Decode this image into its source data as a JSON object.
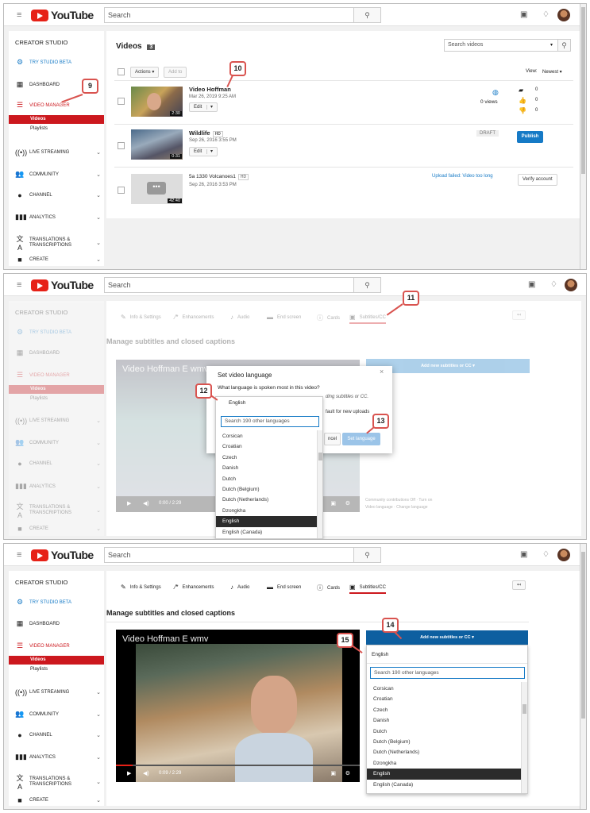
{
  "app": {
    "logo_text": "YouTube",
    "search_placeholder": "Search",
    "colors": {
      "brand_red": "#e62117",
      "accent_blue": "#167ac6",
      "sidebar_active": "#cc181e",
      "callout": "#d9534f"
    },
    "icons": {
      "menu": "hamburger-icon",
      "search": "search-icon",
      "upload": "video-camera-icon",
      "bell": "bell-icon"
    }
  },
  "sidebar": {
    "title": "CREATOR STUDIO",
    "items": [
      {
        "label": "TRY STUDIO BETA",
        "icon": "gear-icon"
      },
      {
        "label": "DASHBOARD",
        "icon": "dashboard-icon"
      },
      {
        "label": "VIDEO MANAGER",
        "icon": "video-manager-icon"
      },
      {
        "label": "LIVE STREAMING",
        "icon": "live-icon"
      },
      {
        "label": "COMMUNITY",
        "icon": "community-icon"
      },
      {
        "label": "CHANNEL",
        "icon": "channel-icon"
      },
      {
        "label": "ANALYTICS",
        "icon": "analytics-icon"
      },
      {
        "label": "TRANSLATIONS &",
        "label2": "TRANSCRIPTIONS",
        "icon": "translate-icon"
      },
      {
        "label": "CREATE",
        "icon": "create-icon"
      }
    ],
    "sub_items": [
      "Videos",
      "Playlists"
    ]
  },
  "video_manager": {
    "title": "Videos",
    "count": "3",
    "search_placeholder": "Search videos",
    "actions_label": "Actions ▾",
    "add_to_label": "Add to",
    "view_label": "View:",
    "view_value": "Newest ▾",
    "edit_label": "Edit",
    "videos": [
      {
        "title": "Video Hoffman",
        "date": "Mar 26, 2019 9:25 AM",
        "duration": "2:30",
        "views": "0 views",
        "likes": "0",
        "dislikes": "0",
        "comments": "0"
      },
      {
        "title": "Wildlife",
        "badge": "HD",
        "date": "Sep 26, 2016 3:55 PM",
        "duration": "0:31",
        "status": "DRAFT",
        "action": "Publish"
      },
      {
        "title": "5a 1330 Volcanoes1",
        "badge": "HD",
        "date": "Sep 26, 2016 3:53 PM",
        "duration": "42:40",
        "status": "Upload failed: Video too long",
        "action": "Verify account"
      }
    ]
  },
  "editor": {
    "tabs": [
      "Info & Settings",
      "Enhancements",
      "Audio",
      "End screen",
      "Cards",
      "Subtitles/CC"
    ],
    "heading": "Manage subtitles and closed captions",
    "video_title": "Video Hoffman E wmv",
    "time_panel2": "0:00 / 2:29",
    "time_panel3": "0:09 / 2:29",
    "add_subtitles_label": "Add new subtitles or CC ▾",
    "community_contrib": "Community contributions  Off · Turn on",
    "video_language": "Video language · Change language"
  },
  "dialog": {
    "title": "Set video language",
    "question": "What language is spoken most in this video?",
    "hint1": "ding subtitles or CC.",
    "hint2": "fault for new uploads",
    "cancel_label": "ncel",
    "set_label": "Set language",
    "close": "×"
  },
  "languages": {
    "selected_value": "English",
    "search_placeholder": "Search 190 other languages",
    "list": [
      "Corsican",
      "Croatian",
      "Czech",
      "Danish",
      "Dutch",
      "Dutch (Belgium)",
      "Dutch (Netherlands)",
      "Dzongkha",
      "English",
      "English (Canada)"
    ]
  },
  "callouts": [
    "9",
    "10",
    "11",
    "12",
    "13",
    "14",
    "15"
  ]
}
